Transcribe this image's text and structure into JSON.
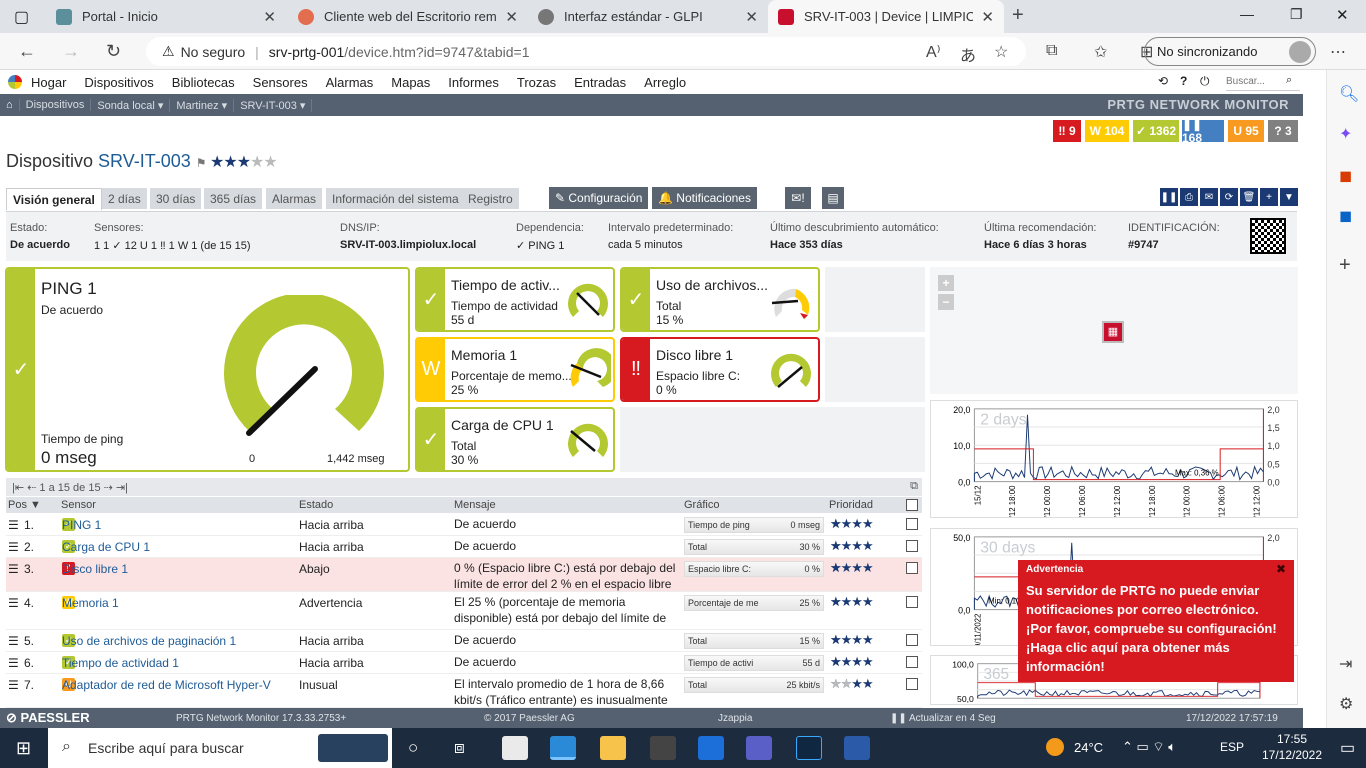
{
  "browser": {
    "tabs": [
      {
        "title": "Portal - Inicio",
        "color": "#5b8f9c"
      },
      {
        "title": "Cliente web del Escritorio remot",
        "color": "#e36d4f"
      },
      {
        "title": "Interfaz estándar - GLPI",
        "color": "#666666"
      },
      {
        "title": "SRV-IT-003 | Device | LIMPIOLUX",
        "color": "#c8102e"
      }
    ],
    "insecure_label": "No seguro",
    "url_host": "srv-prtg-001",
    "url_path": "/device.htm?id=9747&tabid=1",
    "sync_label": "No sincronizando"
  },
  "menu": {
    "items": [
      "Hogar",
      "Dispositivos",
      "Bibliotecas",
      "Sensores",
      "Alarmas",
      "Mapas",
      "Informes",
      "Trozas",
      "Entradas",
      "Arreglo"
    ],
    "search_placeholder": "Buscar...",
    "brand": "PRTG NETWORK MONITOR"
  },
  "breadcrumb": [
    "Dispositivos",
    "Sonda local ▾",
    "Martinez ▾",
    "SRV-IT-003 ▾"
  ],
  "badges": [
    {
      "label": "‼ 9",
      "color": "#d71920"
    },
    {
      "label": "W 104",
      "color": "#ffcb05"
    },
    {
      "label": "✓ 1362",
      "color": "#b4c832"
    },
    {
      "label": "❚❚ 168",
      "color": "#447fc1"
    },
    {
      "label": "U 95",
      "color": "#f79a1f"
    },
    {
      "label": "? 3",
      "color": "#808080"
    }
  ],
  "device": {
    "prefix": "Dispositivo",
    "name": "SRV-IT-003",
    "stars": "★★★★★",
    "stars_filled": 3
  },
  "tabs": [
    "Visión general",
    "2 días",
    "30 días",
    "365 días",
    "Alarmas",
    "Información del sistema",
    "Registro"
  ],
  "buttons": {
    "config": "✎ Configuración",
    "notif": "🔔 Notificaciones"
  },
  "info": {
    "estado_label": "Estado:",
    "estado": "De acuerdo",
    "sensores_label": "Sensores:",
    "sensores": "1 1 ✓ 12  U 1  ‼ 1  W 1   (de 15 15)",
    "dns_label": "DNS/IP:",
    "dns": "SRV-IT-003.limpiolux.local",
    "dep_label": "Dependencia:",
    "dep": "✓ PING 1",
    "int_label": "Intervalo predeterminado:",
    "int": "cada 5 minutos",
    "disc_label": "Último descubrimiento automático:",
    "disc": "Hace 353 días",
    "rec_label": "Última recomendación:",
    "rec": "Hace 6 días 3 horas",
    "id_label": "IDENTIFICACIÓN:",
    "id": "#9747"
  },
  "ping": {
    "name": "PING 1",
    "status": "De acuerdo",
    "label": "Tiempo de ping",
    "value": "0 mseg",
    "min": "0",
    "max": "1,442 mseg"
  },
  "gauges": [
    {
      "name": "Tiempo de activ...",
      "sub": "Tiempo de actividad",
      "value": "55 d",
      "icon": "✓",
      "state": "ok"
    },
    {
      "name": "Uso de archivos...",
      "sub": "Total",
      "value": "15 %",
      "icon": "✓",
      "state": "ok"
    },
    {
      "name": "Memoria 1",
      "sub": "Porcentaje de memo...",
      "value": "25 %",
      "icon": "W",
      "state": "warn"
    },
    {
      "name": "Disco libre 1",
      "sub": "Espacio libre C:",
      "value": "0 %",
      "icon": "‼",
      "state": "down"
    },
    {
      "name": "Carga de CPU 1",
      "sub": "Total",
      "value": "30 %",
      "icon": "✓",
      "state": "ok"
    }
  ],
  "table": {
    "pager": "|⇤ ⇠ 1 a 15 de 15 ⇢ ⇥|",
    "columns": [
      "Pos ▼",
      "Sensor",
      "Estado",
      "Mensaje",
      "Gráfico",
      "Prioridad"
    ],
    "rows": [
      {
        "pos": "1.",
        "icon": "✓",
        "icolor": "#b4c832",
        "sensor": "PING 1",
        "estado": "Hacia arriba",
        "msg": "De acuerdo",
        "glabel": "Tiempo de ping",
        "gval": "0 mseg",
        "stars": "★★★★★",
        "cls": ""
      },
      {
        "pos": "2.",
        "icon": "✓",
        "icolor": "#b4c832",
        "sensor": "Carga de CPU 1",
        "estado": "Hacia arriba",
        "msg": "De acuerdo",
        "glabel": "Total",
        "gval": "30 %",
        "stars": "★★★★★",
        "cls": ""
      },
      {
        "pos": "3.",
        "icon": "‼",
        "icolor": "#d71920",
        "sensor": "Disco libre 1",
        "estado": "Abajo",
        "msg": "0 % (Espacio libre C:) está por debajo del límite de error del 2 % en el espacio libre C:",
        "glabel": "Espacio libre C:",
        "gval": "0 %",
        "stars": "★★★★★",
        "cls": "dn"
      },
      {
        "pos": "4.",
        "icon": "W",
        "icolor": "#ffcb05",
        "sensor": "Memoria 1",
        "estado": "Advertencia",
        "msg": "El 25 % (porcentaje de memoria disponible) está por debajo del límite de advertencia",
        "glabel": "Porcentaje de me",
        "gval": "25 %",
        "stars": "★★★★★",
        "cls": ""
      },
      {
        "pos": "5.",
        "icon": "✓",
        "icolor": "#b4c832",
        "sensor": "Uso de archivos de paginación 1",
        "estado": "Hacia arriba",
        "msg": "De acuerdo",
        "glabel": "Total",
        "gval": "15 %",
        "stars": "★★★★★",
        "cls": ""
      },
      {
        "pos": "6.",
        "icon": "✓",
        "icolor": "#b4c832",
        "sensor": "Tiempo de actividad 1",
        "estado": "Hacia arriba",
        "msg": "De acuerdo",
        "glabel": "Tiempo de activi",
        "gval": "55 d",
        "stars": "★★★★★",
        "cls": ""
      },
      {
        "pos": "7.",
        "icon": "U",
        "icolor": "#f79a1f",
        "sensor": "Adaptador de red de Microsoft Hyper-V",
        "estado": "Inusual",
        "msg": "El intervalo promedio de 1 hora de 8,66 kbit/s (Tráfico entrante) es inusualmente ba",
        "glabel": "Total",
        "gval": "25 kbit/s",
        "stars": "★★★★★",
        "cls": ""
      }
    ]
  },
  "charts": [
    {
      "label": "2 days",
      "y": [
        "20,0",
        "10,0",
        "0,0"
      ],
      "y2": [
        "2,0",
        "1,5",
        "1,0",
        "0,5",
        "0,0"
      ],
      "x": [
        "15/12",
        "16/12 18:00",
        "16/12 00:00",
        "16/12 06:00",
        "16/12 12:00",
        "16/12 18:00",
        "17/12 00:00",
        "17/12 06:00",
        "17/12 12:00"
      ],
      "maxlbl": "Max: 0,36 %"
    },
    {
      "label": "30 days",
      "y": [
        "50,0",
        "0,0"
      ],
      "y2": [
        "2,0"
      ],
      "x": [
        "19/11/2022",
        "21/11/2022"
      ],
      "minlbl": "Min: 0,10"
    },
    {
      "label": "365",
      "y": [
        "100,0",
        "50,0"
      ],
      "y2": [],
      "x": []
    }
  ],
  "alert": {
    "title": "Advertencia",
    "body": "Su servidor de PRTG no puede enviar notificaciones por correo electrónico. ¡Por favor, compruebe su configuración! ¡Haga clic aquí para obtener más información!"
  },
  "footer": {
    "brand": "⊘ PAESSLER",
    "version": "PRTG Network Monitor 17.3.33.2753+",
    "copy": "© 2017 Paessler AG",
    "user": "Jzappia",
    "refresh": "❚❚ Actualizar en 4 Seg",
    "time": "17/12/2022 17:57:19"
  },
  "taskbar": {
    "search": "Escribe aquí para buscar",
    "temp": "24°C",
    "lang": "ESP",
    "time": "17:55",
    "date": "17/12/2022"
  }
}
